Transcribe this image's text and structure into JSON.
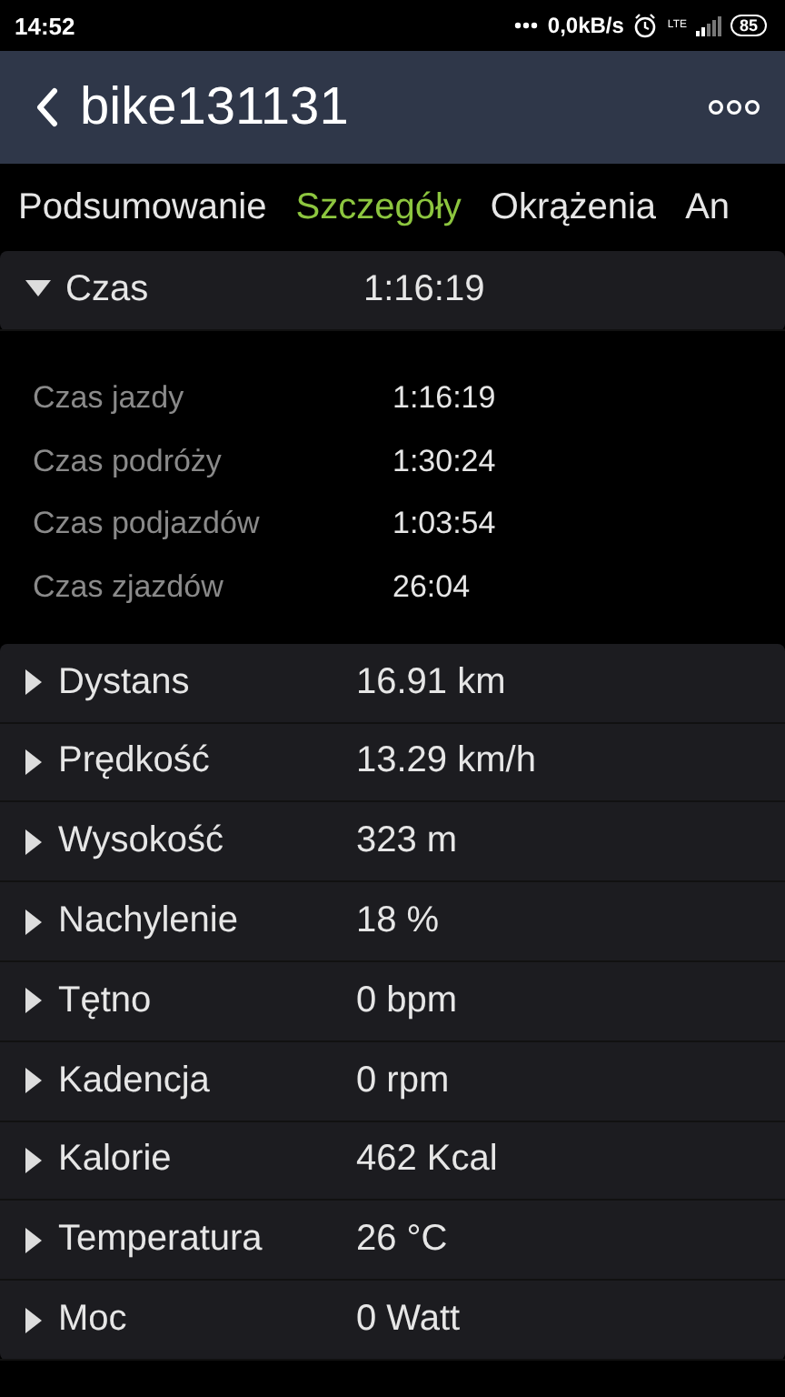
{
  "status_bar": {
    "time": "14:52",
    "speed": "0,0kB/s",
    "network": "LTE",
    "battery": "85"
  },
  "app_bar": {
    "title": "bike131131"
  },
  "tabs": [
    {
      "label": "Podsumowanie",
      "selected": false
    },
    {
      "label": "Szczegóły",
      "selected": true
    },
    {
      "label": "Okrążenia",
      "selected": false
    },
    {
      "label": "An",
      "selected": false
    }
  ],
  "sections": [
    {
      "name": "Czas",
      "value": "1:16:19",
      "expanded": true,
      "details": [
        {
          "label": "Czas jazdy",
          "value": "1:16:19"
        },
        {
          "label": "Czas podróży",
          "value": "1:30:24"
        },
        {
          "label": "Czas podjazdów",
          "value": "1:03:54"
        },
        {
          "label": "Czas zjazdów",
          "value": "26:04"
        }
      ]
    },
    {
      "name": "Dystans",
      "value": "16.91 km",
      "expanded": false
    },
    {
      "name": "Prędkość",
      "value": "13.29 km/h",
      "expanded": false
    },
    {
      "name": "Wysokość",
      "value": "323 m",
      "expanded": false
    },
    {
      "name": "Nachylenie",
      "value": "18 %",
      "expanded": false
    },
    {
      "name": "Tętno",
      "value": "0 bpm",
      "expanded": false
    },
    {
      "name": "Kadencja",
      "value": "0 rpm",
      "expanded": false
    },
    {
      "name": "Kalorie",
      "value": "462 Kcal",
      "expanded": false
    },
    {
      "name": "Temperatura",
      "value": "26 °C",
      "expanded": false
    },
    {
      "name": "Moc",
      "value": "0 Watt",
      "expanded": false
    }
  ]
}
